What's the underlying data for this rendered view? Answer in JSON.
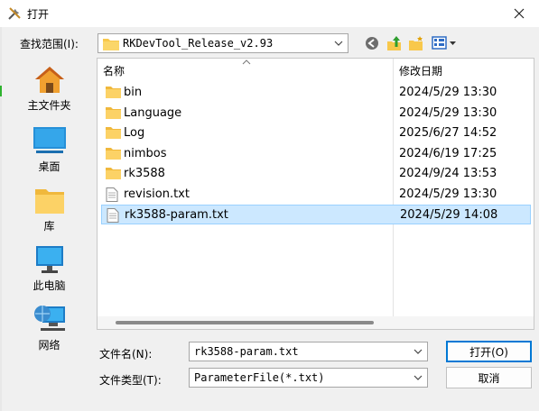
{
  "window": {
    "title": "打开",
    "title_icon": "tools-icon",
    "close_icon": "close-icon"
  },
  "lookin": {
    "label": "查找范围(I):",
    "value": "RKDevTool_Release_v2.93",
    "toolbar": [
      "back-icon",
      "up-folder-icon",
      "new-folder-icon",
      "view-menu-icon"
    ]
  },
  "places": [
    {
      "label": "主文件夹",
      "icon": "home-icon"
    },
    {
      "label": "桌面",
      "icon": "desktop-icon"
    },
    {
      "label": "库",
      "icon": "library-icon"
    },
    {
      "label": "此电脑",
      "icon": "computer-icon"
    },
    {
      "label": "网络",
      "icon": "network-icon"
    }
  ],
  "filelist": {
    "columns": {
      "name": "名称",
      "date": "修改日期"
    },
    "rows": [
      {
        "name": "bin",
        "date": "2024/5/29 13:30",
        "type": "folder",
        "selected": false
      },
      {
        "name": "Language",
        "date": "2024/5/29 13:30",
        "type": "folder",
        "selected": false
      },
      {
        "name": "Log",
        "date": "2025/6/27 14:52",
        "type": "folder",
        "selected": false
      },
      {
        "name": "nimbos",
        "date": "2024/6/19 17:25",
        "type": "folder",
        "selected": false
      },
      {
        "name": "rk3588",
        "date": "2024/9/24 13:53",
        "type": "folder",
        "selected": false
      },
      {
        "name": "revision.txt",
        "date": "2024/5/29 13:30",
        "type": "file",
        "selected": false
      },
      {
        "name": "rk3588-param.txt",
        "date": "2024/5/29 14:08",
        "type": "file",
        "selected": true
      }
    ]
  },
  "filename": {
    "label": "文件名(N):",
    "value": "rk3588-param.txt"
  },
  "filetype": {
    "label": "文件类型(T):",
    "value": "ParameterFile(*.txt)"
  },
  "buttons": {
    "open": "打开(O)",
    "cancel": "取消"
  },
  "colors": {
    "accent": "#0078d4",
    "selection": "#cce8ff",
    "folder": "#f8c84b"
  }
}
